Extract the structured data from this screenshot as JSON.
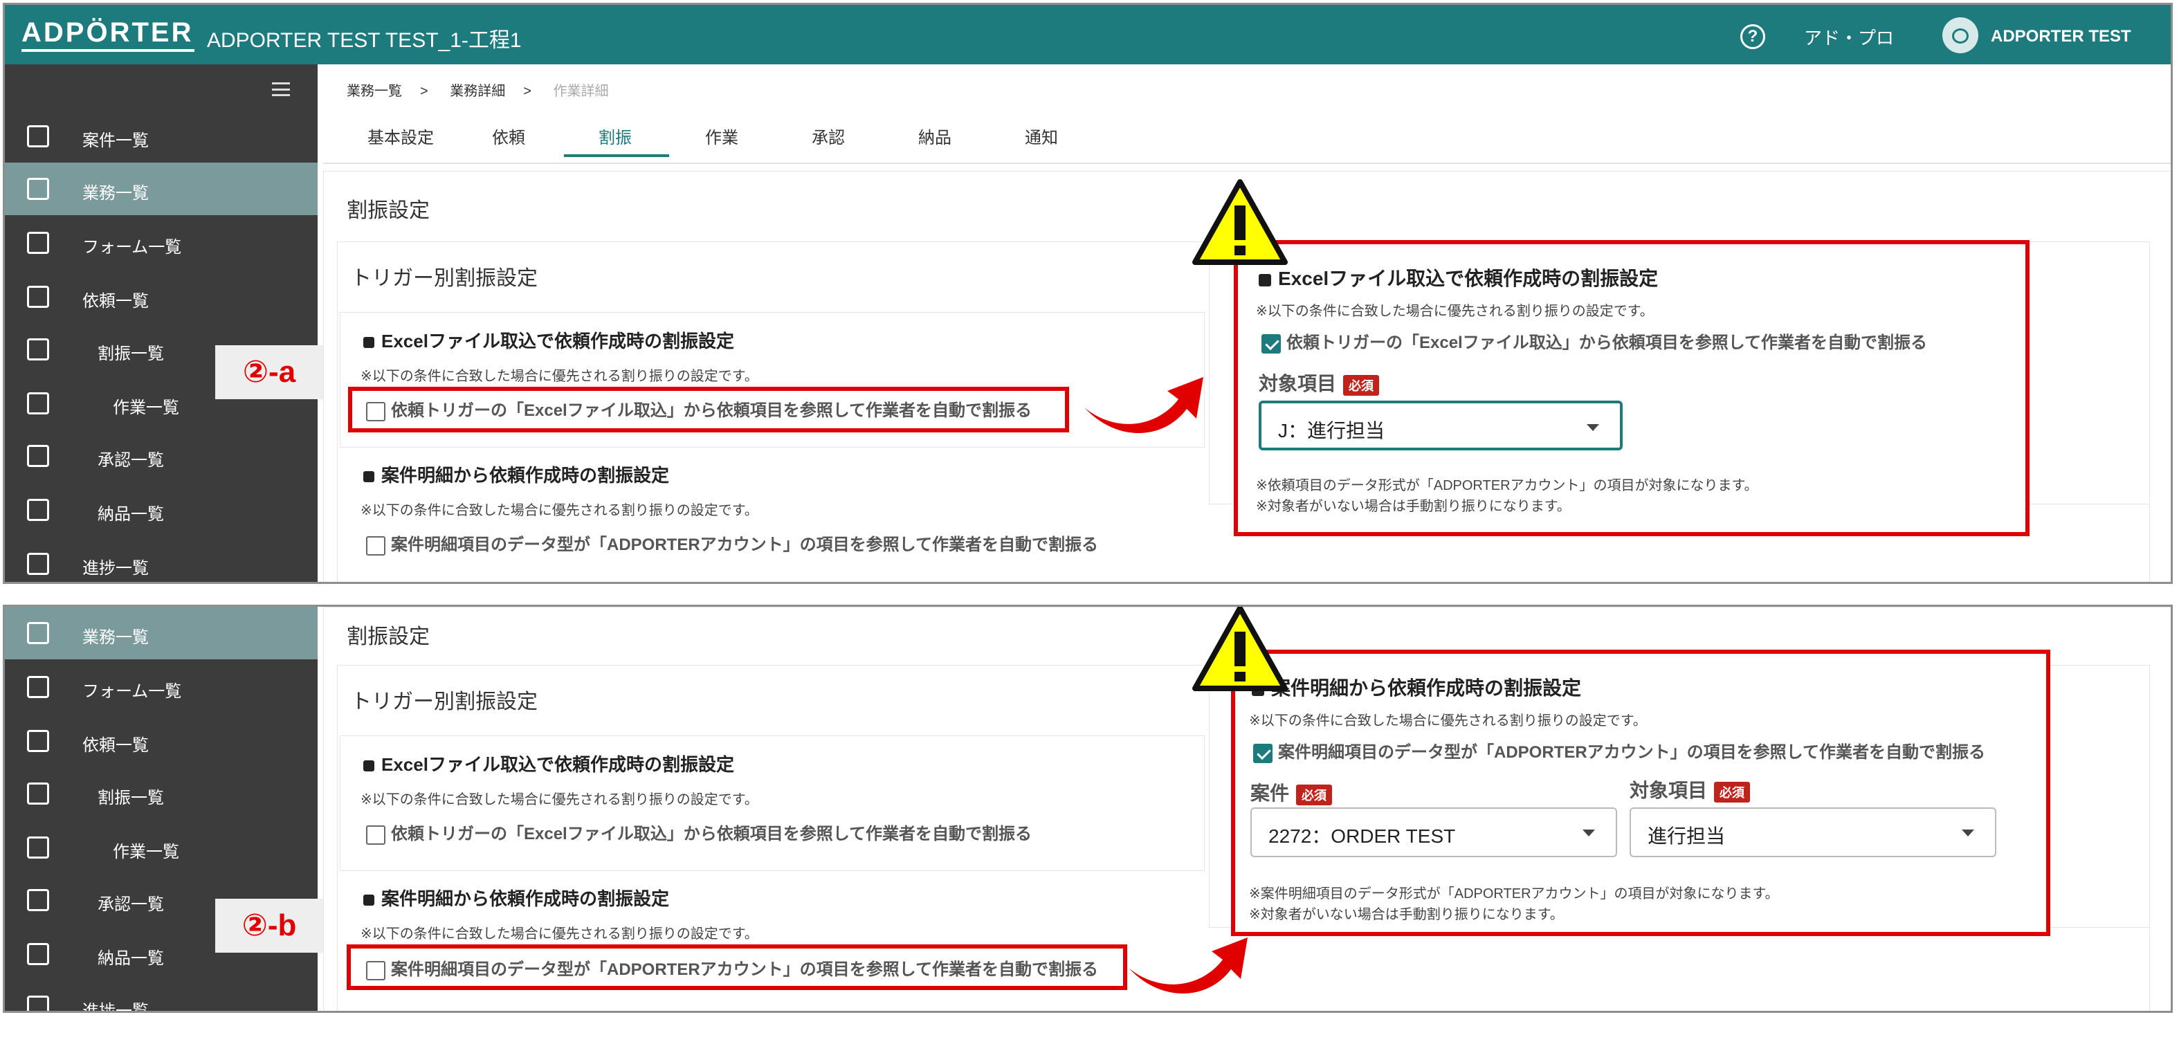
{
  "header": {
    "logo": "ADPÖRTER",
    "title": "ADPORTER TEST TEST_1-工程1",
    "help_icon": "question-circle-icon",
    "org": "アド・プロ",
    "user": "ADPORTER TEST"
  },
  "sidebar": {
    "items_a": [
      "案件一覧",
      "業務一覧",
      "フォーム一覧",
      "依頼一覧",
      "割振一覧",
      "作業一覧",
      "承認一覧",
      "納品一覧",
      "進捗一覧"
    ],
    "items_b": [
      "業務一覧",
      "フォーム一覧",
      "依頼一覧",
      "割振一覧",
      "作業一覧",
      "承認一覧",
      "納品一覧",
      "進捗一覧"
    ],
    "active": "業務一覧"
  },
  "breadcrumb": [
    "業務一覧",
    "業務詳細",
    "作業詳細"
  ],
  "tabs": [
    "基本設定",
    "依頼",
    "割振",
    "作業",
    "承認",
    "納品",
    "通知"
  ],
  "active_tab": "割振",
  "settings": {
    "heading": "割振設定",
    "trigger_heading": "トリガー別割振設定",
    "excel_title": "Excelファイル取込で依頼作成時の割振設定",
    "note": "※以下の条件に合致した場合に優先される割り振りの設定です。",
    "excel_check": "依頼トリガーの「Excelファイル取込」から依頼項目を参照して作業者を自動で割振る",
    "case_title": "案件明細から依頼作成時の割振設定",
    "case_check": "案件明細項目のデータ型が「ADPORTERアカウント」の項目を参照して作業者を自動で割振る"
  },
  "labels": {
    "a": "②-a",
    "b": "②-b"
  },
  "zoom_a": {
    "title": "Excelファイル取込で依頼作成時の割振設定",
    "note": "※以下の条件に合致した場合に優先される割り振りの設定です。",
    "check": "依頼トリガーの「Excelファイル取込」から依頼項目を参照して作業者を自動で割振る",
    "field_label": "対象項目",
    "required": "必須",
    "select_value": "J：進行担当",
    "note1": "※依頼項目のデータ形式が「ADPORTERアカウント」の項目が対象になります。",
    "note2": "※対象者がいない場合は手動割り振りになります。"
  },
  "zoom_b": {
    "title": "案件明細から依頼作成時の割振設定",
    "note": "※以下の条件に合致した場合に優先される割り振りの設定です。",
    "check": "案件明細項目のデータ型が「ADPORTERアカウント」の項目を参照して作業者を自動で割振る",
    "case_label": "案件",
    "required": "必須",
    "case_value": "2272：ORDER TEST",
    "field_label": "対象項目",
    "field_value": "進行担当",
    "note1": "※案件明細項目のデータ形式が「ADPORTERアカウント」の項目が対象になります。",
    "note2": "※対象者がいない場合は手動割り振りになります。"
  },
  "colors": {
    "header": "#1d7a7d",
    "sidebar": "#3c3c3c",
    "active_nav": "#7a9a9c",
    "highlight": "#e10000",
    "required": "#c0231c"
  }
}
